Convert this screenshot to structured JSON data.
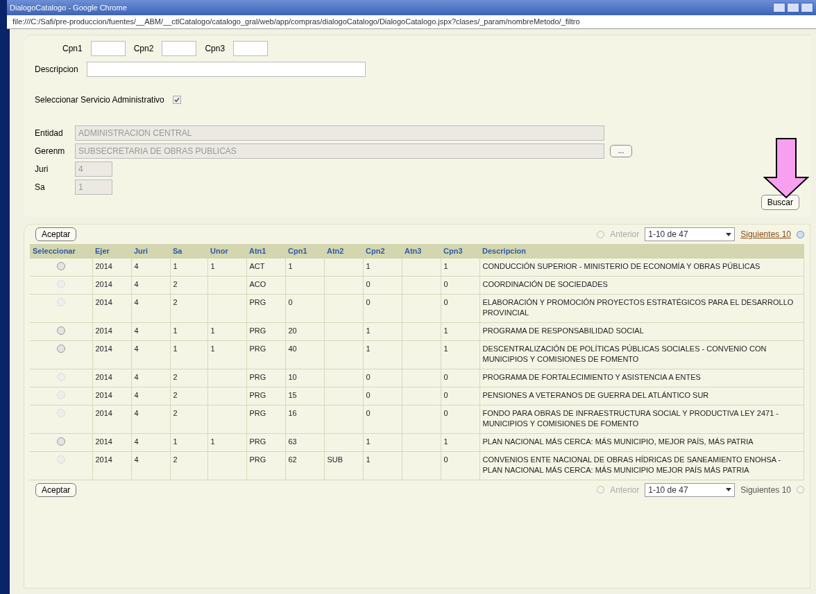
{
  "window": {
    "title": "DialogoCatalogo - Google Chrome",
    "url": "file:///C:/Safi/pre-produccion/fuentes/__ABM/__ctlCatalogo/catalogo_gral/web/app/compras/dialogoCatalogo/DialogoCatalogo.jspx?clases/_param/nombreMetodo/_filtro"
  },
  "filters": {
    "cpn_fields": [
      {
        "label": "Cpn1"
      },
      {
        "label": "Cpn2"
      },
      {
        "label": "Cpn3"
      }
    ],
    "descripcion": {
      "label": "Descripcion"
    },
    "servicio_checkbox": {
      "label": "Seleccionar Servicio Administrativo",
      "checked": true
    },
    "entidad": {
      "label": "Entidad",
      "value": "ADMINISTRACION CENTRAL"
    },
    "gerencia": {
      "label": "Gerenm",
      "value": "SUBSECRETARIA DE OBRAS PUBLICAS"
    },
    "browse_button": "...",
    "juri": {
      "label": "Juri",
      "value": "4"
    },
    "sa": {
      "label": "Sa",
      "value": "1"
    },
    "search_button": "Buscar"
  },
  "results": {
    "accept_button_top": "Aceptar",
    "accept_button_bottom": "Aceptar",
    "pager_top": {
      "previous": "Anterior",
      "range": "1-10 de 47",
      "next": "Siguientes 10",
      "next_enabled": true
    },
    "pager_bottom": {
      "previous": "Anterior",
      "range": "1-10 de 47",
      "next": "Siguientes 10",
      "next_enabled": false
    },
    "select_column": "Seleccionar",
    "columns": [
      "Ejer",
      "Juri",
      "Sa",
      "Unor",
      "Atn1",
      "Cpn1",
      "Atn2",
      "Cpn2",
      "Atn3",
      "Cpn3",
      "Descripcion"
    ],
    "rows": [
      {
        "selected": false,
        "disabled": false,
        "cells": [
          "2014",
          "4",
          "1",
          "1",
          "ACT",
          "1",
          "",
          "1",
          "",
          "1",
          "CONDUCCIÓN SUPERIOR - MINISTERIO DE ECONOMÍA Y OBRAS PÚBLICAS"
        ]
      },
      {
        "selected": false,
        "disabled": true,
        "cells": [
          "2014",
          "4",
          "2",
          "",
          "ACO",
          "",
          "",
          "0",
          "",
          "0",
          "COORDINACIÓN DE SOCIEDADES"
        ]
      },
      {
        "selected": false,
        "disabled": true,
        "cells": [
          "2014",
          "4",
          "2",
          "",
          "PRG",
          "0",
          "",
          "0",
          "",
          "0",
          "ELABORACIÓN Y PROMOCIÓN PROYECTOS ESTRATÉGICOS PARA EL DESARROLLO PROVINCIAL"
        ]
      },
      {
        "selected": false,
        "disabled": false,
        "cells": [
          "2014",
          "4",
          "1",
          "1",
          "PRG",
          "20",
          "",
          "1",
          "",
          "1",
          "PROGRAMA DE RESPONSABILIDAD SOCIAL"
        ]
      },
      {
        "selected": false,
        "disabled": false,
        "cells": [
          "2014",
          "4",
          "1",
          "1",
          "PRG",
          "40",
          "",
          "1",
          "",
          "1",
          "DESCENTRALIZACIÓN DE POLÍTICAS PÚBLICAS SOCIALES - CONVENIO CON MUNICIPIOS Y COMISIONES DE FOMENTO"
        ]
      },
      {
        "selected": false,
        "disabled": true,
        "cells": [
          "2014",
          "4",
          "2",
          "",
          "PRG",
          "10",
          "",
          "0",
          "",
          "0",
          "PROGRAMA DE FORTALECIMIENTO Y ASISTENCIA A ENTES"
        ]
      },
      {
        "selected": false,
        "disabled": true,
        "cells": [
          "2014",
          "4",
          "2",
          "",
          "PRG",
          "15",
          "",
          "0",
          "",
          "0",
          "PENSIONES A VETERANOS DE GUERRA DEL ATLÁNTICO SUR"
        ]
      },
      {
        "selected": false,
        "disabled": true,
        "cells": [
          "2014",
          "4",
          "2",
          "",
          "PRG",
          "16",
          "",
          "0",
          "",
          "0",
          "FONDO PARA OBRAS DE INFRAESTRUCTURA SOCIAL Y PRODUCTIVA LEY 2471 - MUNICIPIOS Y COMISIONES DE FOMENTO"
        ]
      },
      {
        "selected": false,
        "disabled": false,
        "cells": [
          "2014",
          "4",
          "1",
          "1",
          "PRG",
          "63",
          "",
          "1",
          "",
          "1",
          "PLAN NACIONAL MÁS CERCA: MÁS MUNICIPIO, MEJOR PAÍS, MÁS PATRIA"
        ]
      },
      {
        "selected": false,
        "disabled": true,
        "cells": [
          "2014",
          "4",
          "2",
          "",
          "PRG",
          "62",
          "SUB",
          "1",
          "",
          "0",
          "CONVENIOS ENTE NACIONAL DE OBRAS HÍDRICAS DE SANEAMIENTO ENOHSA - PLAN NACIONAL MÁS CERCA: MÁS MUNICIPIO MEJOR PAÍS MÁS PATRIA"
        ]
      }
    ]
  }
}
